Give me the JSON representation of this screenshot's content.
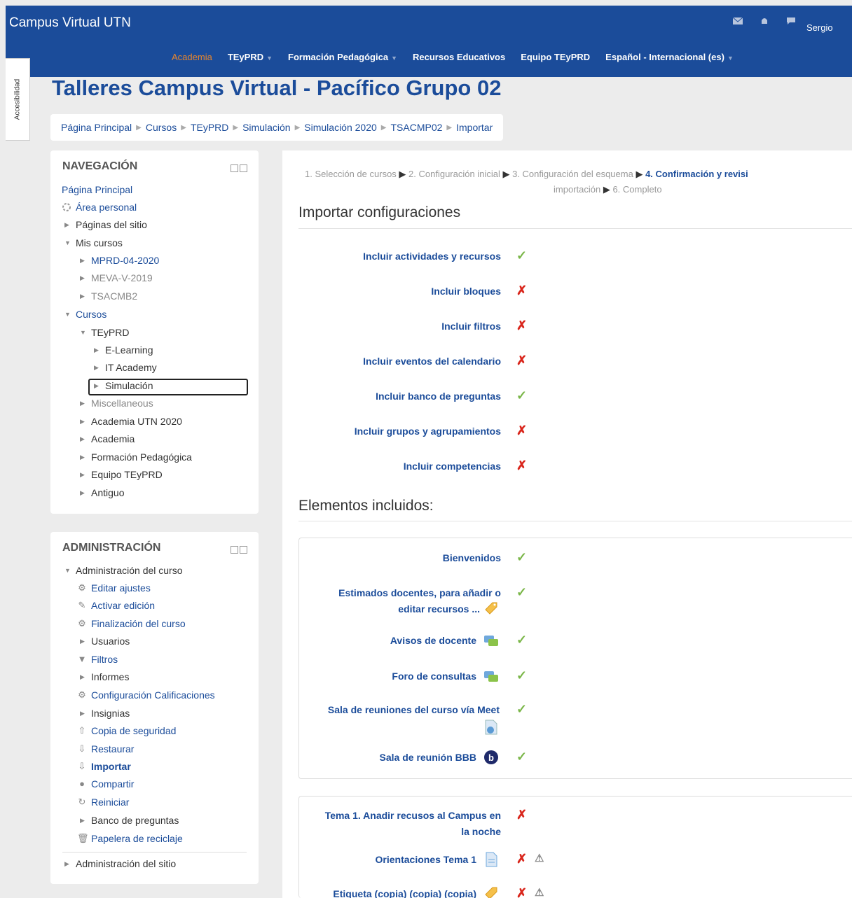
{
  "navbar": {
    "brand": "Campus Virtual UTN",
    "user": "Sergio",
    "icons": [
      "envelope-icon",
      "bell-icon",
      "chat-icon"
    ],
    "menu": [
      {
        "label": "Academia",
        "active": true,
        "dropdown": false
      },
      {
        "label": "TEyPRD",
        "active": false,
        "dropdown": true
      },
      {
        "label": "Formación Pedagógica",
        "active": false,
        "dropdown": true
      },
      {
        "label": "Recursos Educativos",
        "active": false,
        "dropdown": false
      },
      {
        "label": "Equipo TEyPRD",
        "active": false,
        "dropdown": false
      },
      {
        "label": "Español - Internacional (es)",
        "active": false,
        "dropdown": true
      }
    ]
  },
  "accessibility_tab": "Accesibilidad",
  "page_title": "Talleres Campus Virtual - Pacífico Grupo 02",
  "breadcrumb": [
    "Página Principal",
    "Cursos",
    "TEyPRD",
    "Simulación",
    "Simulación 2020",
    "TSACMP02",
    "Importar"
  ],
  "navigation": {
    "title": "NAVEGACIÓN",
    "items": [
      "Página Principal",
      "Área personal",
      "Páginas del sitio",
      "Mis cursos",
      "MPRD-04-2020",
      "MEVA-V-2019",
      "TSACMB2",
      "Cursos",
      "TEyPRD",
      "E-Learning",
      "IT Academy",
      "Simulación",
      "Miscellaneous",
      "Academia UTN 2020",
      "Academia",
      "Formación Pedagógica",
      "Equipo TEyPRD",
      "Antiguo"
    ]
  },
  "administration": {
    "title": "ADMINISTRACIÓN",
    "items": [
      "Administración del curso",
      "Editar ajustes",
      "Activar edición",
      "Finalización del curso",
      "Usuarios",
      "Filtros",
      "Informes",
      "Configuración Calificaciones",
      "Insignias",
      "Copia de seguridad",
      "Restaurar",
      "Importar",
      "Compartir",
      "Reiniciar",
      "Banco de preguntas",
      "Papelera de reciclaje",
      "Administración del sitio"
    ]
  },
  "steps": {
    "s1": "1. Selección de cursos",
    "s2": "2. Configuración inicial",
    "s3": "3. Configuración del esquema",
    "s4": "4. Confirmación y revisi",
    "s5": "importación",
    "s6": "6. Completo"
  },
  "import_settings": {
    "heading": "Importar configuraciones",
    "rows": [
      {
        "label": "Incluir actividades y recursos",
        "included": true
      },
      {
        "label": "Incluir bloques",
        "included": false
      },
      {
        "label": "Incluir filtros",
        "included": false
      },
      {
        "label": "Incluir eventos del calendario",
        "included": false
      },
      {
        "label": "Incluir banco de preguntas",
        "included": true
      },
      {
        "label": "Incluir grupos y agrupamientos",
        "included": false
      },
      {
        "label": "Incluir competencias",
        "included": false
      }
    ]
  },
  "included_items": {
    "heading": "Elementos incluidos:",
    "section0": [
      {
        "line1": "Bienvenidos",
        "included": true
      },
      {
        "line1": "Estimados docentes, para añadir o",
        "line2": "editar recursos ...",
        "icon": "label-icon",
        "included": true
      },
      {
        "line1": "Avisos de docente",
        "icon": "forum-icon",
        "included": true
      },
      {
        "line1": "Foro de consultas",
        "icon": "forum-icon",
        "included": true
      },
      {
        "line1": "Sala de reuniones del curso vía Meet",
        "icon": "url-icon",
        "included": true
      },
      {
        "line1": "Sala de reunión BBB",
        "icon": "bigbluebutton-icon",
        "included": true
      }
    ],
    "section1": [
      {
        "line1": "Tema 1. Anadir recusos al Campus en",
        "line2": "la noche",
        "included": false
      },
      {
        "line1": "Orientaciones Tema 1",
        "icon": "page-icon",
        "included": false
      },
      {
        "line1": "Etiqueta (copia) (copia) (copia)",
        "icon": "label-icon",
        "included": false
      }
    ]
  },
  "marks": {
    "ok": "✓",
    "no": "✗",
    "user_data": "⚠"
  }
}
